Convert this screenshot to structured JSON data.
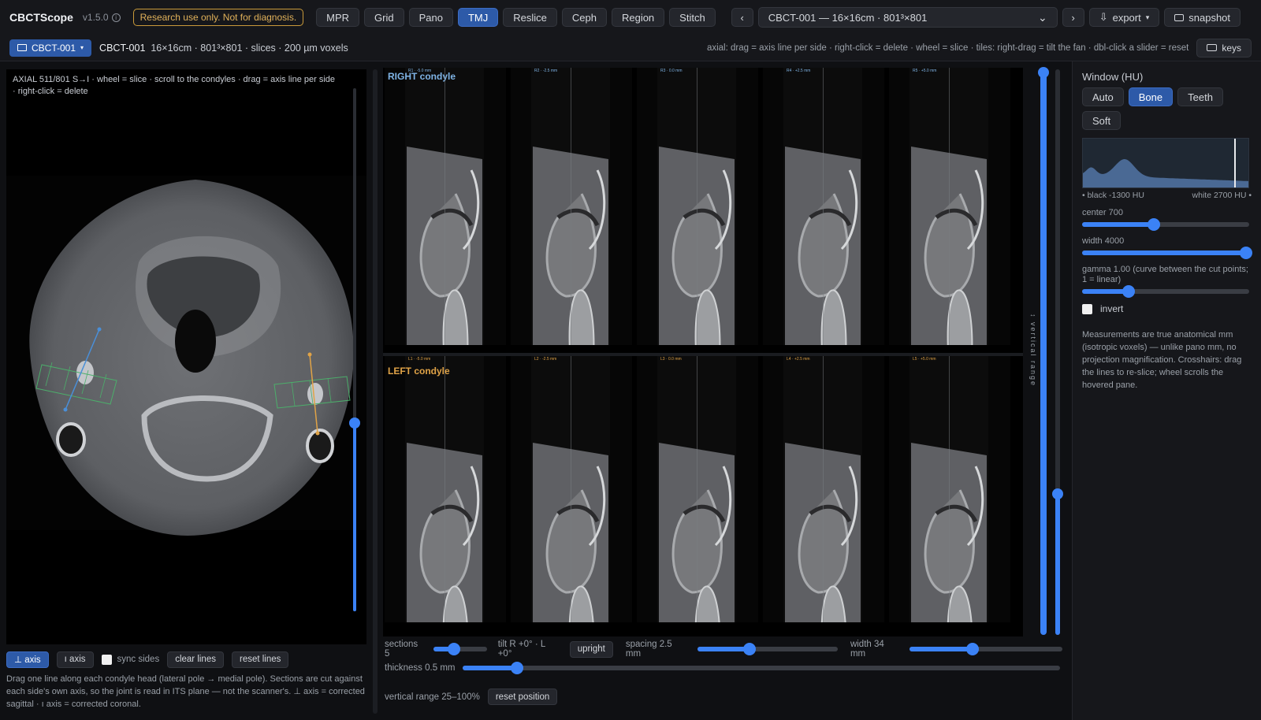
{
  "app": {
    "name": "CBCTScope",
    "version": "v1.5.0",
    "warning": "Research use only. Not for diagnosis."
  },
  "modes": [
    {
      "label": "MPR",
      "active": false
    },
    {
      "label": "Grid",
      "active": false
    },
    {
      "label": "Pano",
      "active": false
    },
    {
      "label": "TMJ",
      "active": true
    },
    {
      "label": "Reslice",
      "active": false
    },
    {
      "label": "Ceph",
      "active": false
    },
    {
      "label": "Region",
      "active": false
    },
    {
      "label": "Stitch",
      "active": false
    }
  ],
  "nav": {
    "prev": "‹",
    "next": "›"
  },
  "dataset": {
    "selected": "CBCT-001 — 16×16cm · 801³×801",
    "caret": "⌄"
  },
  "actions": {
    "export": "export",
    "snapshot": "snapshot",
    "keys": "keys"
  },
  "subbar": {
    "case_chip": "CBCT-001",
    "case_name": "CBCT-001",
    "case_info": "16×16cm · 801³×801 · slices · 200 µm voxels",
    "hints": "axial: drag = axis line per side · right-click = delete · wheel = slice · tiles: right-drag = tilt the fan · dbl-click a slider = reset"
  },
  "axial": {
    "label": "AXIAL 511/801 S→I · wheel = slice · scroll to the condyles · drag = axis line per side · right-click = delete",
    "slice_fraction": 0.36
  },
  "left_controls": {
    "perp_axis": "⊥ axis",
    "par_axis": "ı axis",
    "sync_sides": "sync sides",
    "clear_lines": "clear lines",
    "reset_lines": "reset lines",
    "description": "Drag one line along each condyle head (lateral pole → medial pole). Sections are cut against each side's own axis, so the joint is read in ITS plane — not the scanner's. ⊥ axis = corrected sagittal · ı axis = corrected coronal."
  },
  "tmj": {
    "right_label": "RIGHT condyle",
    "left_label": "LEFT condyle",
    "right_color": "#7fb4e6",
    "left_color": "#e0a347",
    "right_tiles": [
      "R1 · -5.0 mm",
      "R2 · -2.5 mm",
      "R3 · 0.0 mm",
      "R4 · +2.5 mm",
      "R5 · +5.0 mm"
    ],
    "left_tiles": [
      "L1 · -5.0 mm",
      "L2 · -2.5 mm",
      "L3 · 0.0 mm",
      "L4 · +2.5 mm",
      "L5 · +5.0 mm"
    ],
    "vertical_range_label": "↕ vertical range"
  },
  "grid_controls": {
    "sections_label": "sections 5",
    "tilt_label": "tilt R +0° · L +0°",
    "upright": "upright",
    "spacing_label": "spacing 2.5 mm",
    "width_label": "width 34 mm",
    "thickness_label": "thickness 0.5 mm",
    "vertical_range": "vertical range 25–100%",
    "reset_position": "reset position",
    "sections_value": 0.38,
    "spacing_value": 0.37,
    "width_value": 0.41,
    "thickness_value": 0.09,
    "vr_low": 0.25,
    "vr_high": 1.0
  },
  "window": {
    "title": "Window (HU)",
    "presets": [
      {
        "label": "Auto",
        "active": false
      },
      {
        "label": "Bone",
        "active": true
      },
      {
        "label": "Teeth",
        "active": false
      },
      {
        "label": "Soft",
        "active": false
      }
    ],
    "black_label": "• black -1300 HU",
    "white_label": "white 2700 HU •",
    "center_label": "center 700",
    "width_label": "width 4000",
    "gamma_label": "gamma 1.00 (curve between the cut points; 1 = linear)",
    "center_value": 0.43,
    "width_value": 0.98,
    "gamma_value": 0.28,
    "invert": "invert",
    "note": "Measurements are true anatomical mm (isotropic voxels) — unlike pano mm, no projection magnification. Crosshairs: drag the lines to re-slice; wheel scrolls the hovered pane."
  }
}
